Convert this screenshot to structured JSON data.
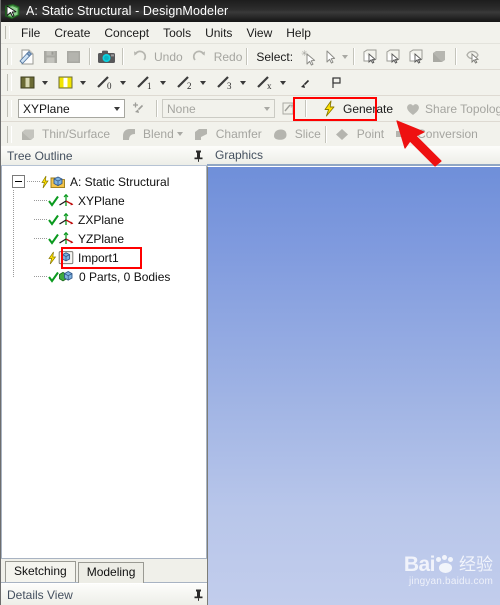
{
  "window": {
    "title": "A: Static Structural - DesignModeler",
    "app_icon": "designmodeler-icon"
  },
  "menu": {
    "items": [
      {
        "label": "File"
      },
      {
        "label": "Create"
      },
      {
        "label": "Concept"
      },
      {
        "label": "Tools"
      },
      {
        "label": "Units"
      },
      {
        "label": "View"
      },
      {
        "label": "Help"
      }
    ]
  },
  "toolbar_standard": {
    "new_label": "new-file",
    "save_label": "save",
    "export_label": "export",
    "image_label": "image-capture",
    "undo_label": "Undo",
    "redo_label": "Redo",
    "select_label": "Select:",
    "select_mode": "single-select",
    "select_mode_dropdown": "select-mode-dropdown",
    "filters": [
      "vertex-filter",
      "edge-filter",
      "face-filter",
      "body-filter",
      "extend-filter"
    ]
  },
  "toolbar_planes": {
    "items": [
      {
        "name": "plane-pair-olive",
        "color": "#6b6b35"
      },
      {
        "name": "plane-pair-yellow",
        "color": "#f2e500"
      },
      {
        "name": "sketch-0",
        "sub": "0"
      },
      {
        "name": "sketch-1",
        "sub": "1"
      },
      {
        "name": "sketch-2",
        "sub": "2"
      },
      {
        "name": "sketch-3",
        "sub": "3"
      },
      {
        "name": "sketch-x",
        "sub": "x"
      }
    ]
  },
  "toolbar_main": {
    "plane_value": "XYPlane",
    "new_plane_label": "new-plane",
    "sketch_value": "None",
    "new_sketch_label": "new-sketch",
    "generate_label": "Generate",
    "share_topology_label": "Share Topology",
    "generate_highlight_color": "#ff0000"
  },
  "toolbar_features": {
    "items": [
      {
        "label": "Thin/Surface",
        "icon": "thin-surface-icon",
        "has_caret": false
      },
      {
        "label": "Blend",
        "icon": "blend-icon",
        "has_caret": true
      },
      {
        "label": "Chamfer",
        "icon": "chamfer-icon",
        "has_caret": false
      },
      {
        "label": "Slice",
        "icon": "slice-icon",
        "has_caret": false
      },
      {
        "label": "Point",
        "icon": "point-icon",
        "has_caret": false
      },
      {
        "label": "Conversion",
        "icon": "conversion-icon",
        "has_caret": false
      }
    ]
  },
  "tree_panel": {
    "header": "Tree Outline",
    "pin": "pin-icon",
    "root": {
      "label": "A: Static Structural",
      "icon": "project-icon",
      "state": "pending"
    },
    "nodes": [
      {
        "label": "XYPlane",
        "icon": "plane-icon",
        "state": "ok"
      },
      {
        "label": "ZXPlane",
        "icon": "plane-icon",
        "state": "ok"
      },
      {
        "label": "YZPlane",
        "icon": "plane-icon",
        "state": "ok"
      },
      {
        "label": "Import1",
        "icon": "import-icon",
        "state": "pending",
        "highlighted": true
      },
      {
        "label": "0 Parts, 0 Bodies",
        "icon": "bodies-icon",
        "state": "ok"
      }
    ],
    "highlight_color": "#ff0000"
  },
  "tabs": {
    "items": [
      {
        "label": "Sketching",
        "active": true
      },
      {
        "label": "Modeling",
        "active": false
      }
    ]
  },
  "details_panel": {
    "header": "Details View",
    "pin": "pin-icon"
  },
  "graphics_panel": {
    "header": "Graphics",
    "background_top": "#6f8fd9",
    "background_bottom": "#c2cdec"
  },
  "watermark": {
    "brand": "Bai",
    "mark": "du",
    "suffix": "经验",
    "url": "jingyan.baidu.com"
  },
  "annotation": {
    "arrow_color": "#ee1111",
    "arrow_name": "pointer-arrow-to-generate"
  }
}
